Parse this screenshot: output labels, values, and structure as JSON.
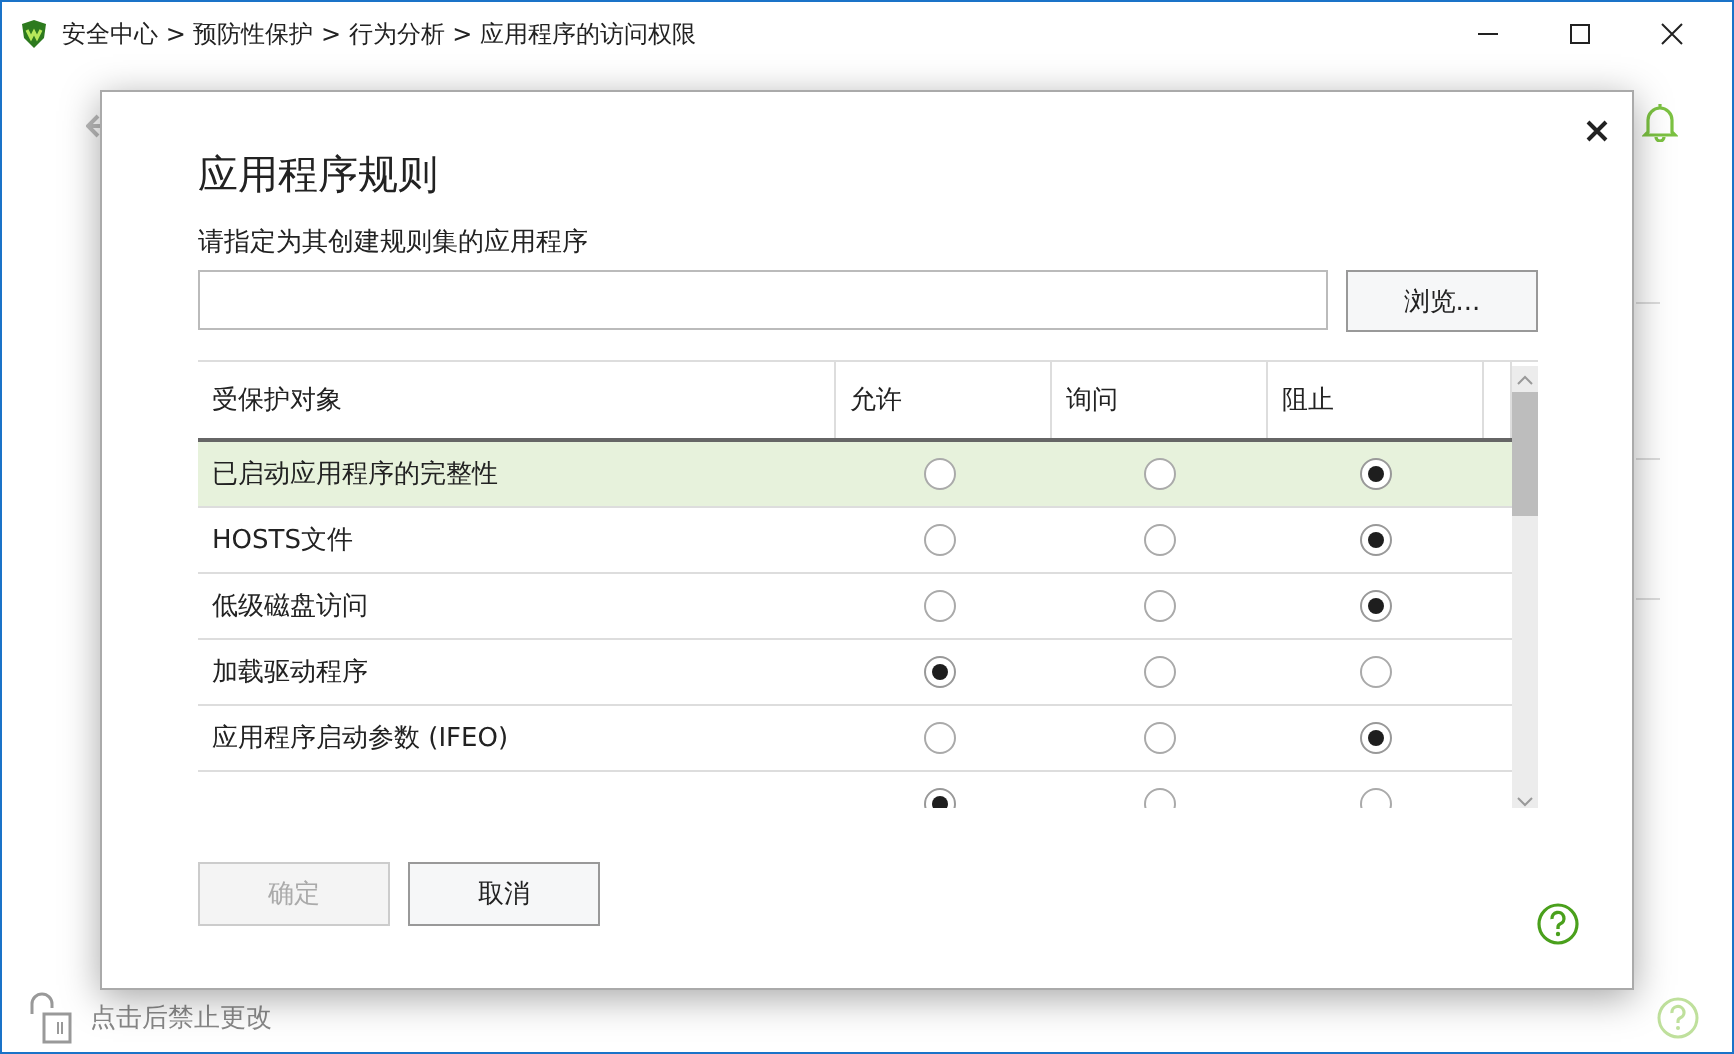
{
  "window": {
    "title": "安全中心 > 预防性保护 > 行为分析 > 应用程序的访问权限"
  },
  "footer": {
    "lock_label": "点击后禁止更改"
  },
  "dialog": {
    "title": "应用程序规则",
    "field_label": "请指定为其创建规则集的应用程序",
    "browse_button": "浏览...",
    "table": {
      "columns": [
        "受保护对象",
        "允许",
        "询问",
        "阻止"
      ],
      "rows": [
        {
          "name": "已启动应用程序的完整性",
          "selected": true,
          "options": [
            {
              "selected": false
            },
            {
              "selected": false
            },
            {
              "selected": true
            }
          ]
        },
        {
          "name": "HOSTS文件",
          "selected": false,
          "options": [
            {
              "selected": false
            },
            {
              "selected": false
            },
            {
              "selected": true
            }
          ]
        },
        {
          "name": "低级磁盘访问",
          "selected": false,
          "options": [
            {
              "selected": false
            },
            {
              "selected": false
            },
            {
              "selected": true
            }
          ]
        },
        {
          "name": "加载驱动程序",
          "selected": false,
          "options": [
            {
              "selected": true
            },
            {
              "selected": false
            },
            {
              "selected": false
            }
          ]
        },
        {
          "name": "应用程序启动参数 (IFEO)",
          "selected": false,
          "options": [
            {
              "selected": false
            },
            {
              "selected": false
            },
            {
              "selected": true
            }
          ]
        },
        {
          "selected": false,
          "options": [
            {
              "selected": true
            },
            {
              "selected": false
            },
            {
              "selected": false
            }
          ]
        }
      ]
    },
    "buttons": [
      {
        "label": "确定",
        "disabled": true
      },
      {
        "label": "取消",
        "disabled": false
      }
    ]
  }
}
